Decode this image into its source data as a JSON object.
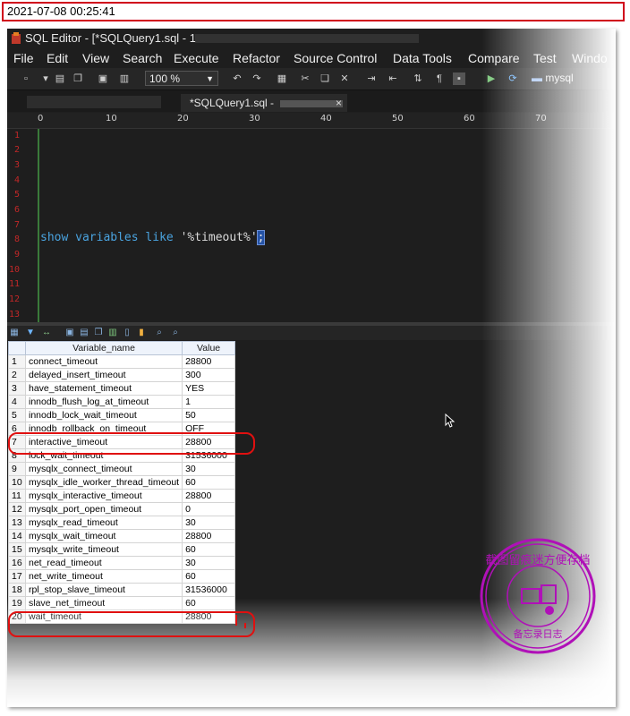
{
  "timestamp": "2021-07-08 00:25:41",
  "window": {
    "title": "SQL Editor - [*SQLQuery1.sql - 1"
  },
  "menu": [
    "File",
    "Edit",
    "View",
    "Search",
    "Execute",
    "Refactor",
    "Source Control",
    "Data Tools",
    "Compare",
    "Test",
    "Windo"
  ],
  "toolbar": {
    "zoom": "100 %",
    "connection": "mysql"
  },
  "tab": {
    "label": "*SQLQuery1.sql -",
    "close": "×"
  },
  "ruler": [
    "0",
    "10",
    "20",
    "30",
    "40",
    "50",
    "60",
    "70"
  ],
  "editor": {
    "line_numbers": [
      "1",
      "2",
      "3",
      "4",
      "5",
      "6",
      "7",
      "8",
      "9",
      "10",
      "11",
      "12",
      "13"
    ],
    "code": {
      "kw1": "show",
      "kw2": "variables",
      "kw3": "like",
      "str": "'%timeout%'",
      "semi": ";"
    }
  },
  "results": {
    "columns": [
      "Variable_name",
      "Value"
    ],
    "rows": [
      [
        "1",
        "connect_timeout",
        "28800"
      ],
      [
        "2",
        "delayed_insert_timeout",
        "300"
      ],
      [
        "3",
        "have_statement_timeout",
        "YES"
      ],
      [
        "4",
        "innodb_flush_log_at_timeout",
        "1"
      ],
      [
        "5",
        "innodb_lock_wait_timeout",
        "50"
      ],
      [
        "6",
        "innodb_rollback_on_timeout",
        "OFF"
      ],
      [
        "7",
        "interactive_timeout",
        "28800"
      ],
      [
        "8",
        "lock_wait_timeout",
        "31536000"
      ],
      [
        "9",
        "mysqlx_connect_timeout",
        "30"
      ],
      [
        "10",
        "mysqlx_idle_worker_thread_timeout",
        "60"
      ],
      [
        "11",
        "mysqlx_interactive_timeout",
        "28800"
      ],
      [
        "12",
        "mysqlx_port_open_timeout",
        "0"
      ],
      [
        "13",
        "mysqlx_read_timeout",
        "30"
      ],
      [
        "14",
        "mysqlx_wait_timeout",
        "28800"
      ],
      [
        "15",
        "mysqlx_write_timeout",
        "60"
      ],
      [
        "16",
        "net_read_timeout",
        "30"
      ],
      [
        "17",
        "net_write_timeout",
        "60"
      ],
      [
        "18",
        "rpl_stop_slave_timeout",
        "31536000"
      ],
      [
        "19",
        "slave_net_timeout",
        "60"
      ],
      [
        "20",
        "wait_timeout",
        "28800"
      ]
    ]
  },
  "stamp": {
    "outer_text": "截图留痕迷方便存档",
    "inner_text": "备忘录日志"
  },
  "colors": {
    "highlight": "#e01010",
    "stamp": "#b010b8",
    "keyword": "#4aa3df",
    "line_number": "#c12828"
  }
}
